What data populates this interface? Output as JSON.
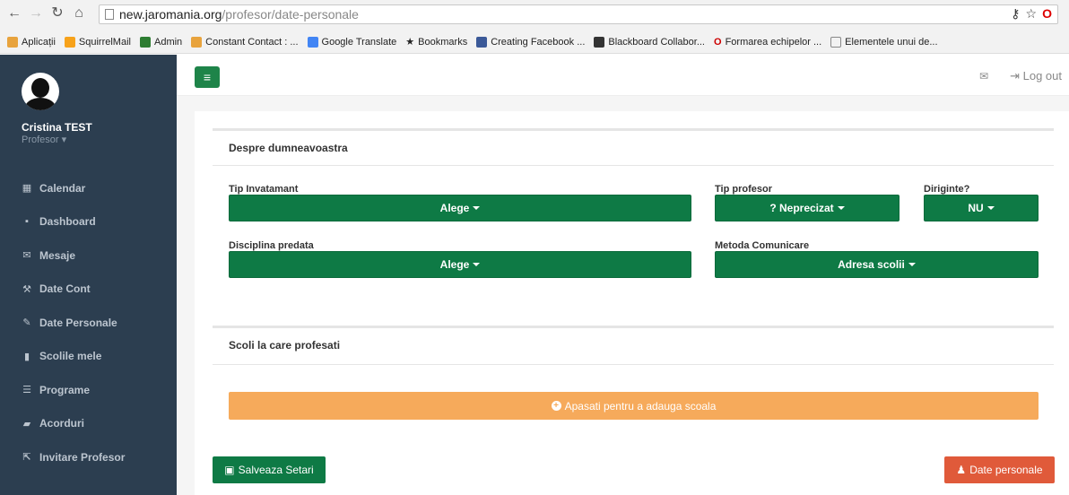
{
  "browser": {
    "url_host": "new.jaromania.org",
    "url_path": "/profesor/date-personale",
    "bookmarks": [
      {
        "label": "Aplicații",
        "icon": "apps-grid-icon",
        "color": "#e8a33d"
      },
      {
        "label": "SquirrelMail",
        "icon": "squirrelmail-icon",
        "color": "#f7a21b"
      },
      {
        "label": "Admin",
        "icon": "admin-icon",
        "color": "#2e7d32"
      },
      {
        "label": "Constant Contact : ...",
        "icon": "constant-contact-icon",
        "color": "#e8a33d"
      },
      {
        "label": "Google Translate",
        "icon": "google-translate-icon",
        "color": "#4285f4"
      },
      {
        "label": "Bookmarks",
        "icon": "star-icon",
        "color": "#555555"
      },
      {
        "label": "Creating Facebook ...",
        "icon": "facebook-doc-icon",
        "color": "#3b5998"
      },
      {
        "label": "Blackboard Collabor...",
        "icon": "blackboard-icon",
        "color": "#333333"
      },
      {
        "label": "Formarea echipelor ...",
        "icon": "opera-icon",
        "color": "#cc0000"
      },
      {
        "label": "Elementele unui de...",
        "icon": "page-icon",
        "color": "#888888"
      }
    ]
  },
  "sidebar": {
    "user_name": "Cristina TEST",
    "user_role": "Profesor",
    "items": [
      {
        "label": "Calendar",
        "icon": "calendar-icon",
        "glyph": "▦"
      },
      {
        "label": "Dashboard",
        "icon": "dashboard-icon",
        "glyph": "▪"
      },
      {
        "label": "Mesaje",
        "icon": "envelope-icon",
        "glyph": "✉"
      },
      {
        "label": "Date Cont",
        "icon": "wrench-icon",
        "glyph": "⚒"
      },
      {
        "label": "Date Personale",
        "icon": "pencil-icon",
        "glyph": "✎"
      },
      {
        "label": "Scolile mele",
        "icon": "building-icon",
        "glyph": "▮"
      },
      {
        "label": "Programe",
        "icon": "list-icon",
        "glyph": "☰"
      },
      {
        "label": "Acorduri",
        "icon": "book-icon",
        "glyph": "▰"
      },
      {
        "label": "Invitare Profesor",
        "icon": "share-icon",
        "glyph": "⇱"
      }
    ]
  },
  "header": {
    "logout_label": "Log out"
  },
  "about_section": {
    "title": "Despre dumneavoastra",
    "tip_invatamant_label": "Tip Invatamant",
    "tip_invatamant_value": "Alege",
    "tip_profesor_label": "Tip profesor",
    "tip_profesor_value": "? Neprecizat",
    "diriginte_label": "Diriginte?",
    "diriginte_value": "NU",
    "disciplina_label": "Disciplina predata",
    "disciplina_value": "Alege",
    "metoda_label": "Metoda Comunicare",
    "metoda_value": "Adresa scolii"
  },
  "schools_section": {
    "title": "Scoli la care profesati",
    "add_label": "Apasati pentru a adauga scoala"
  },
  "footer": {
    "save_label": "Salveaza Setari",
    "personal_label": "Date personale"
  },
  "colors": {
    "sidebar_bg": "#2c3e50",
    "primary_green": "#0e7a45",
    "add_orange": "#f6aa5b",
    "danger_red": "#e05a3a"
  }
}
